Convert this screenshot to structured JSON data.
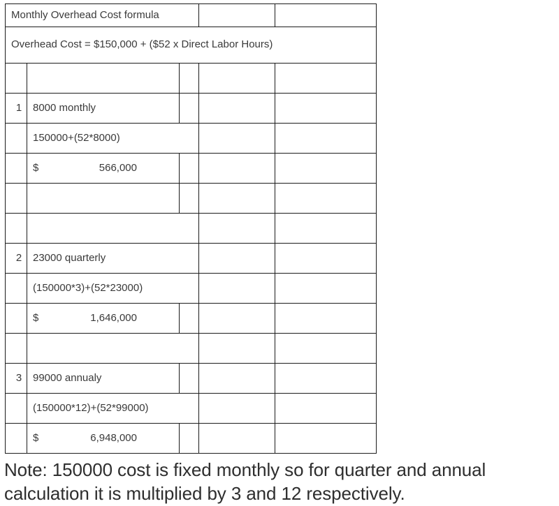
{
  "document": {
    "title": "Monthly Overhead Cost formula"
  },
  "table": {
    "title_row": {
      "label": "Monthly Overhead Cost formula"
    },
    "formula_row": {
      "text": "Overhead Cost = $150,000 + ($52 x Direct Labor Hours)"
    },
    "items": [
      {
        "index": "1",
        "description": "8000 monthly",
        "calculation": "150000+(52*8000)",
        "currency_symbol": "$",
        "result": "566,000"
      },
      {
        "index": "2",
        "description": "23000 quarterly",
        "calculation": "(150000*3)+(52*23000)",
        "currency_symbol": "$",
        "result": "1,646,000"
      },
      {
        "index": "3",
        "description": "99000 annualy",
        "calculation": "(150000*12)+(52*99000)",
        "currency_symbol": "$",
        "result": "6,948,000"
      }
    ]
  },
  "note": {
    "text": "Note: 150000 cost is fixed monthly so for quarter and annual calculation it is multiplied by 3 and 12 respectively."
  },
  "colors": {
    "border": "#1c1c1c",
    "text": "#3a3a3a",
    "note_text": "#2e2e2e",
    "background": "#ffffff"
  }
}
